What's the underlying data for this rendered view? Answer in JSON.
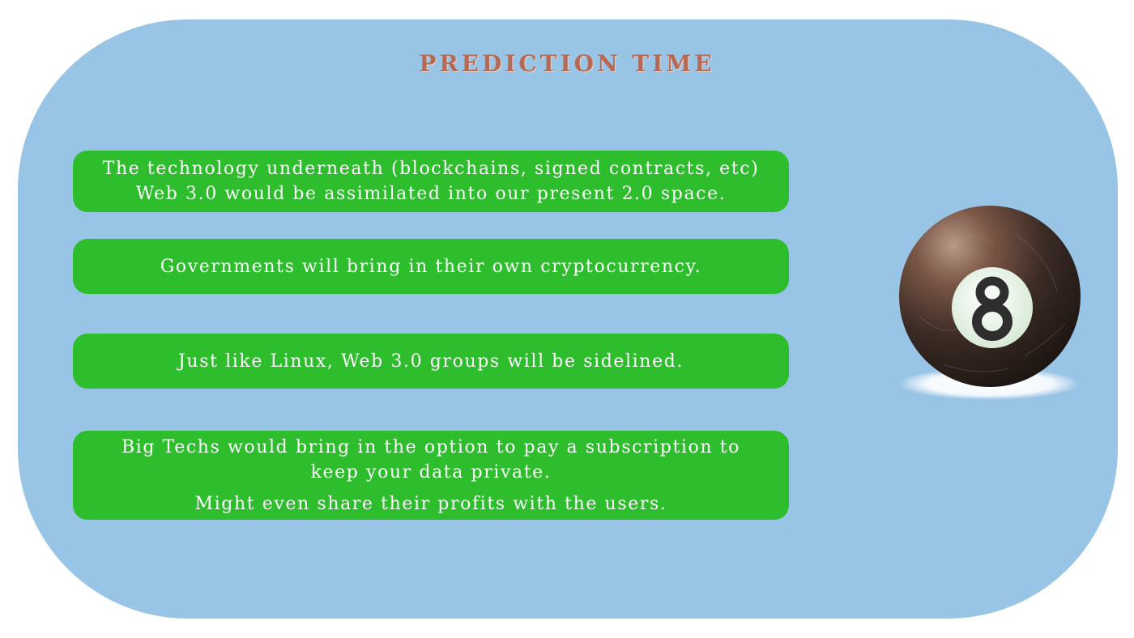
{
  "title": "PREDICTION TIME",
  "predictions": [
    {
      "lines": [
        "The technology underneath (blockchains, signed contracts, etc)",
        "Web 3.0 would be assimilated into our present 2.0 space."
      ]
    },
    {
      "lines": [
        "Governments will bring in their own cryptocurrency."
      ]
    },
    {
      "lines": [
        "Just like Linux, Web 3.0 groups will be sidelined."
      ]
    },
    {
      "lines": [
        "Big Techs would bring in the option to pay a subscription to",
        "keep your data private.",
        "Might even share their profits with the users."
      ]
    }
  ],
  "ball": {
    "number": "8",
    "icon": "eight-ball-icon"
  },
  "colors": {
    "background": "#98c4e6",
    "pill": "#2dbd2d",
    "title": "#b56a55",
    "text": "#ffffff"
  }
}
